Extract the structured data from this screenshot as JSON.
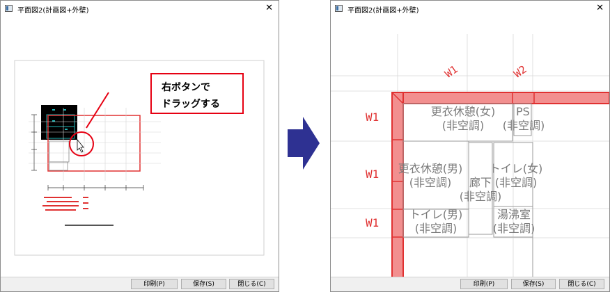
{
  "left_window": {
    "title": "平面図2(計画図+外壁)",
    "close_glyph": "✕",
    "buttons": {
      "print": "印刷(P)",
      "save": "保存(S)",
      "close": "閉じる(C)"
    },
    "callout": {
      "line1": "右ボタンで",
      "line2": "ドラッグする"
    }
  },
  "right_window": {
    "title": "平面図2(計画図+外壁)",
    "close_glyph": "✕",
    "buttons": {
      "print": "印刷(P)",
      "save": "保存(S)",
      "close": "閉じる(C)"
    },
    "wall_labels": {
      "top_1": "W1",
      "top_2": "W2",
      "left_1": "W1",
      "left_2": "W1",
      "left_3": "W1"
    },
    "rooms": {
      "r1_l1": "更衣休憩(女)",
      "r1_l2": "(非空調)",
      "r2_l1": "PS",
      "r2_l2": "(非空調)",
      "r3_l1": "更衣休憩(男)",
      "r3_l2": "(非空調)",
      "r4_l1": "トイレ(女)",
      "r4_l2": "(非空調)",
      "r5_l1": "廊下",
      "r5_l2": "(非空調)",
      "r6_l1": "トイレ(男)",
      "r6_l2": "(非空調)",
      "r7_l1": "湯沸室",
      "r7_l2": "(非空調)"
    }
  },
  "colors": {
    "accent_red": "#e03131",
    "wall_fill": "#f28f8f",
    "arrow": "#2e3192",
    "callout_border": "#e60012"
  }
}
